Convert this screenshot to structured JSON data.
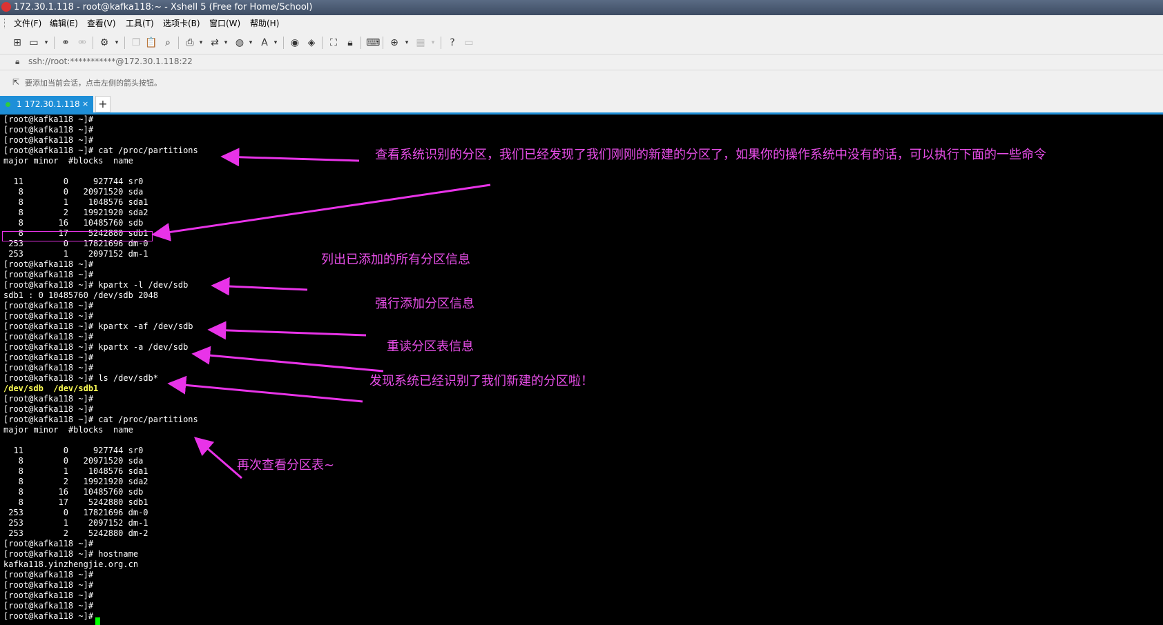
{
  "window": {
    "title": "172.30.1.118 - root@kafka118:~ - Xshell 5 (Free for Home/School)"
  },
  "menu": [
    "文件(F)",
    "编辑(E)",
    "查看(V)",
    "工具(T)",
    "选项卡(B)",
    "窗口(W)",
    "帮助(H)"
  ],
  "address": "ssh://root:***********@172.30.1.118:22",
  "hint": "要添加当前会话，点击左侧的箭头按钮。",
  "tab": {
    "label": "1 172.30.1.118",
    "close": "×",
    "add": "+"
  },
  "terminal_lines": [
    "[root@kafka118 ~]#",
    "[root@kafka118 ~]#",
    "[root@kafka118 ~]#",
    "[root@kafka118 ~]# cat /proc/partitions",
    "major minor  #blocks  name",
    "",
    "  11        0     927744 sr0",
    "   8        0   20971520 sda",
    "   8        1    1048576 sda1",
    "   8        2   19921920 sda2",
    "   8       16   10485760 sdb",
    "   8       17    5242880 sdb1",
    " 253        0   17821696 dm-0",
    " 253        1    2097152 dm-1",
    "[root@kafka118 ~]#",
    "[root@kafka118 ~]#",
    "[root@kafka118 ~]# kpartx -l /dev/sdb",
    "sdb1 : 0 10485760 /dev/sdb 2048",
    "[root@kafka118 ~]#",
    "[root@kafka118 ~]#",
    "[root@kafka118 ~]# kpartx -af /dev/sdb",
    "[root@kafka118 ~]#",
    "[root@kafka118 ~]# kpartx -a /dev/sdb",
    "[root@kafka118 ~]#",
    "[root@kafka118 ~]#",
    "[root@kafka118 ~]# ls /dev/sdb*",
    "/dev/sdb  /dev/sdb1",
    "[root@kafka118 ~]#",
    "[root@kafka118 ~]#",
    "[root@kafka118 ~]# cat /proc/partitions",
    "major minor  #blocks  name",
    "",
    "  11        0     927744 sr0",
    "   8        0   20971520 sda",
    "   8        1    1048576 sda1",
    "   8        2   19921920 sda2",
    "   8       16   10485760 sdb",
    "   8       17    5242880 sdb1",
    " 253        0   17821696 dm-0",
    " 253        1    2097152 dm-1",
    " 253        2    5242880 dm-2",
    "[root@kafka118 ~]#",
    "[root@kafka118 ~]# hostname",
    "kafka118.yinzhengjie.org.cn",
    "[root@kafka118 ~]#",
    "[root@kafka118 ~]#",
    "[root@kafka118 ~]#",
    "[root@kafka118 ~]#",
    "[root@kafka118 ~]#"
  ],
  "annotations": [
    "查看系统识别的分区，我们已经发现了我们刚刚的新建的分区了，如果你的操作系统中没有的话，可以执行下面的一些命令",
    "列出已添加的所有分区信息",
    "强行添加分区信息",
    "重读分区表信息",
    "发现系统已经识别了我们新建的分区啦！",
    "再次查看分区表~"
  ],
  "colors": {
    "annotation": "#e84ee8",
    "tab_accent": "#1e8fd8",
    "prompt_text": "#ffffff",
    "ls_output": "#ffff55",
    "cursor": "#00ff00"
  }
}
